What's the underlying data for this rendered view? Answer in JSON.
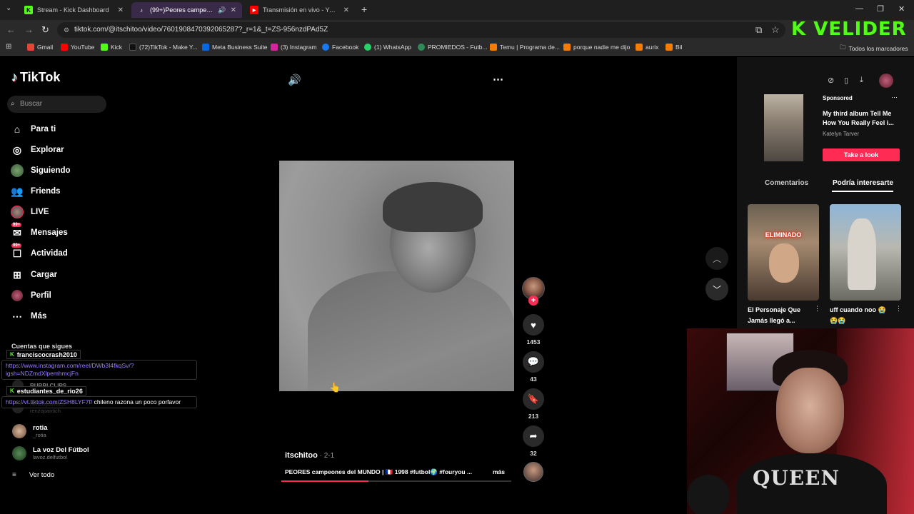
{
  "browser": {
    "tabs": [
      {
        "title": "Stream - Kick Dashboard",
        "active": false
      },
      {
        "title": "(99+)Peores campeones del",
        "active": true
      },
      {
        "title": "Transmisión en vivo - YouTube",
        "active": false
      }
    ],
    "new_tab": "+",
    "url": "tiktok.com/@itschitoo/video/7601908470392065287?_r=1&_t=ZS-956nzdPAd5Z",
    "bookmarks": [
      "Gmail",
      "YouTube",
      "Kick",
      "(72)TikTok - Make Y...",
      "Meta Business Suite",
      "(3) Instagram",
      "Facebook",
      "(1) WhatsApp",
      "PROMIEDOS - Futb...",
      "Temu | Programa de...",
      "porque nadie me dijo",
      "aurix",
      "Bil"
    ],
    "bookmarks_all": "Todos los marcadores"
  },
  "overlay_logo": "K VELIDER",
  "sidebar": {
    "logo": "TikTok",
    "search_placeholder": "Buscar",
    "nav": [
      {
        "label": "Para ti",
        "icon": "home-icon"
      },
      {
        "label": "Explorar",
        "icon": "compass-icon"
      },
      {
        "label": "Siguiendo",
        "icon": "following-icon"
      },
      {
        "label": "Friends",
        "icon": "friends-icon"
      },
      {
        "label": "LIVE",
        "icon": "live-icon"
      },
      {
        "label": "Mensajes",
        "icon": "messages-icon",
        "badge": "99+"
      },
      {
        "label": "Actividad",
        "icon": "activity-icon",
        "badge": "99+"
      },
      {
        "label": "Cargar",
        "icon": "upload-icon"
      },
      {
        "label": "Perfil",
        "icon": "profile-icon"
      },
      {
        "label": "Más",
        "icon": "more-icon"
      }
    ],
    "following_header": "Cuentas que sigues",
    "accounts": [
      {
        "name": "rotia",
        "handle": "_rotia"
      },
      {
        "name": "La voz Del Fútbol",
        "handle": "lavoz.delfutbol"
      }
    ],
    "partial_accounts": [
      "BURBI CLIPS",
      "renzopantich",
      "renzopantich"
    ],
    "see_all": "Ver todo"
  },
  "chat": [
    {
      "user": "franciscocrash2010",
      "message": "https://www.instagram.com/reel/DWb3I4fkqSv/?igsh=NDZmdXlpemhmcjFn",
      "extra": ""
    },
    {
      "user": "estudiantes_de_rio26",
      "message": "https://vt.tiktok.com/ZSH8LYF7f/",
      "extra": " chileno razona un poco porfavor"
    }
  ],
  "video": {
    "username": "itschitoo",
    "date": " · 2-1",
    "description": "PEORES campeones del MUNDO | 🇫🇷 1998 #futbol🌍 #fouryou ...",
    "more": "más",
    "progress": 0.38,
    "likes": "1453",
    "comments": "43",
    "saves": "213",
    "shares": "32"
  },
  "right_panel": {
    "sponsored": "Sponsored",
    "ad_title": "My third album Tell Me How You Really Feel i...",
    "ad_artist": "Katelyn Tarver",
    "ad_button": "Take a look",
    "tabs": [
      "Comentarios",
      "Podría interesarte"
    ],
    "active_tab": 1,
    "suggestions": [
      {
        "caption": "El Personaje Que Jamás llegó a...",
        "overlay": "ELIMINADO"
      },
      {
        "caption": "uff cuando noo 😭 😭😭",
        "overlay": ""
      }
    ]
  },
  "webcam": {
    "shirt_text": "QUEEN"
  },
  "colors": {
    "tiktok_red": "#fe2c55",
    "kick_green": "#53fc18",
    "chat_link": "#9a7dff"
  }
}
